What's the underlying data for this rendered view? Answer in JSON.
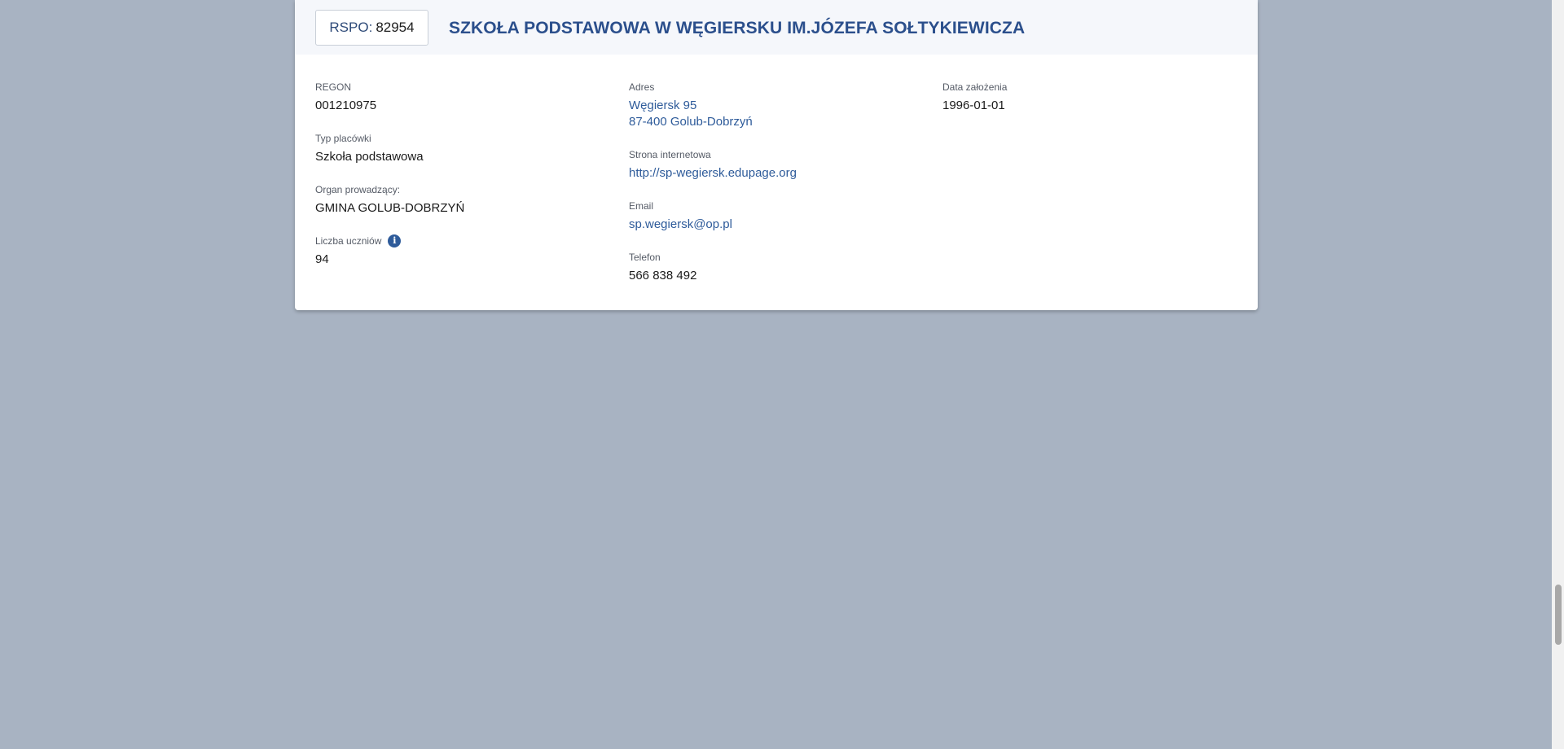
{
  "header": {
    "rspo_label": "RSPO:",
    "rspo_value": "82954",
    "school_name": "SZKOŁA PODSTAWOWA W WĘGIERSKU IM.JÓZEFA SOŁTYKIEWICZA"
  },
  "details": {
    "regon": {
      "label": "REGON",
      "value": "001210975"
    },
    "type": {
      "label": "Typ placówki",
      "value": "Szkoła podstawowa"
    },
    "organ": {
      "label": "Organ prowadzący:",
      "value": "GMINA GOLUB-DOBRZYŃ"
    },
    "students": {
      "label": "Liczba uczniów",
      "value": "94",
      "icon": "info-icon"
    },
    "address": {
      "label": "Adres",
      "line1": "Węgiersk 95",
      "line2": "87-400 Golub-Dobrzyń"
    },
    "website": {
      "label": "Strona internetowa",
      "value": "http://sp-wegiersk.edupage.org"
    },
    "email": {
      "label": "Email",
      "value": "sp.wegiersk@op.pl"
    },
    "phone": {
      "label": "Telefon",
      "value": "566 838 492"
    },
    "founded": {
      "label": "Data założenia",
      "value": "1996-01-01"
    }
  },
  "colors": {
    "background": "#a8b3c2",
    "title": "#2b4f8c",
    "link": "#2e5b9a"
  }
}
